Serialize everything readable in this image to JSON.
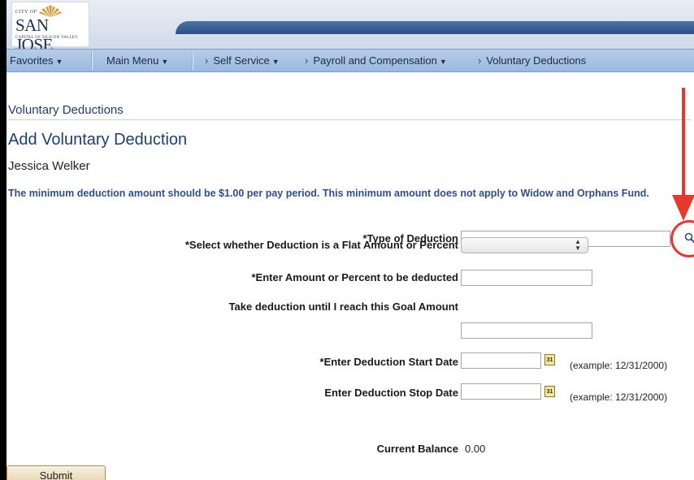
{
  "logo": {
    "city_of": "CITY OF",
    "name": "SAN JOSE",
    "tagline": "CAPITAL OF SILICON VALLEY"
  },
  "nav": {
    "favorites": "Favorites",
    "main_menu": "Main Menu",
    "self_service": "Self Service",
    "payroll": "Payroll and Compensation",
    "current": "Voluntary Deductions"
  },
  "page": {
    "section_title": "Voluntary Deductions",
    "heading": "Add Voluntary Deduction",
    "employee_name": "Jessica Welker",
    "notice": "The minimum deduction amount should be $1.00 per pay period. This minimum amount does not apply to Widow and Orphans Fund."
  },
  "form": {
    "type_label": "*Type of Deduction",
    "type_value": "",
    "flat_or_percent_label": "*Select whether Deduction is a Flat Amount or Percent",
    "flat_or_percent_value": "",
    "amount_label": "*Enter Amount or Percent to be deducted",
    "amount_value": "",
    "goal_label": "Take deduction until I reach this Goal Amount",
    "goal_value": "",
    "start_label": "*Enter Deduction Start Date",
    "start_value": "",
    "start_example": "(example: 12/31/2000)",
    "stop_label": "Enter Deduction Stop Date",
    "stop_value": "",
    "stop_example": "(example: 12/31/2000)",
    "balance_label": "Current Balance",
    "balance_value": "0.00",
    "calendar_day": "31",
    "submit_label": "Submit"
  },
  "colors": {
    "heading_blue": "#1e3f6e",
    "notice_blue": "#2f4f86",
    "annotation_red": "#e8382e"
  },
  "icons": {
    "lookup": "magnifier-icon",
    "date": "calendar-icon",
    "dropdown": "up-down-chevron-icon"
  }
}
